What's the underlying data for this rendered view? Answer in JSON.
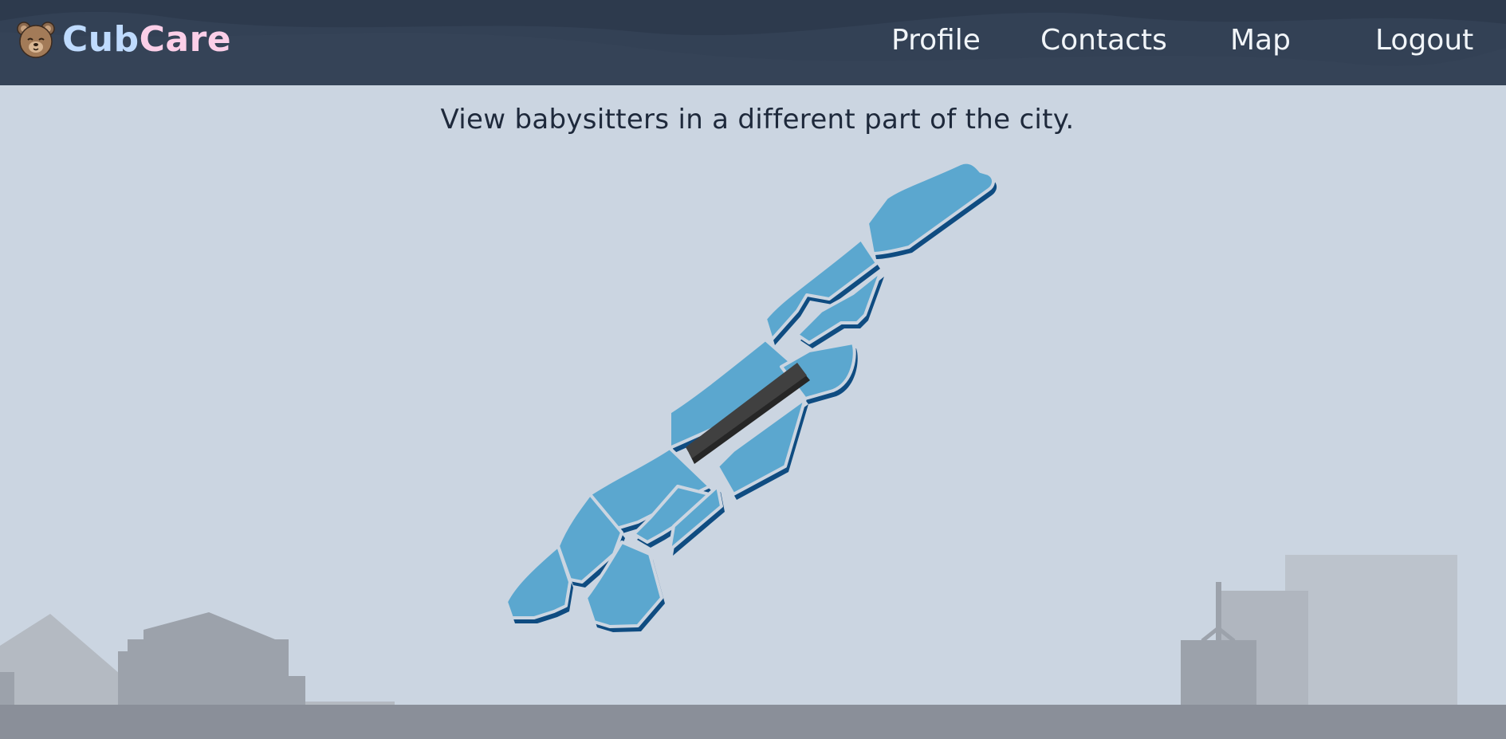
{
  "brand": {
    "name_part1": "Cub",
    "name_part2": "Care",
    "logo_icon": "bear-face-icon"
  },
  "nav": {
    "profile": "Profile",
    "contacts": "Contacts",
    "map": "Map",
    "logout": "Logout"
  },
  "main": {
    "heading": "View babysitters in a different part of the city."
  },
  "map": {
    "neighborhoods_count": 14,
    "selected_color": "#404040",
    "region_color": "#5ba7cf",
    "region_side_color": "#0f4c81"
  },
  "colors": {
    "navbar": "#334155",
    "background": "#cbd5e1",
    "ground": "#8a8f99"
  }
}
